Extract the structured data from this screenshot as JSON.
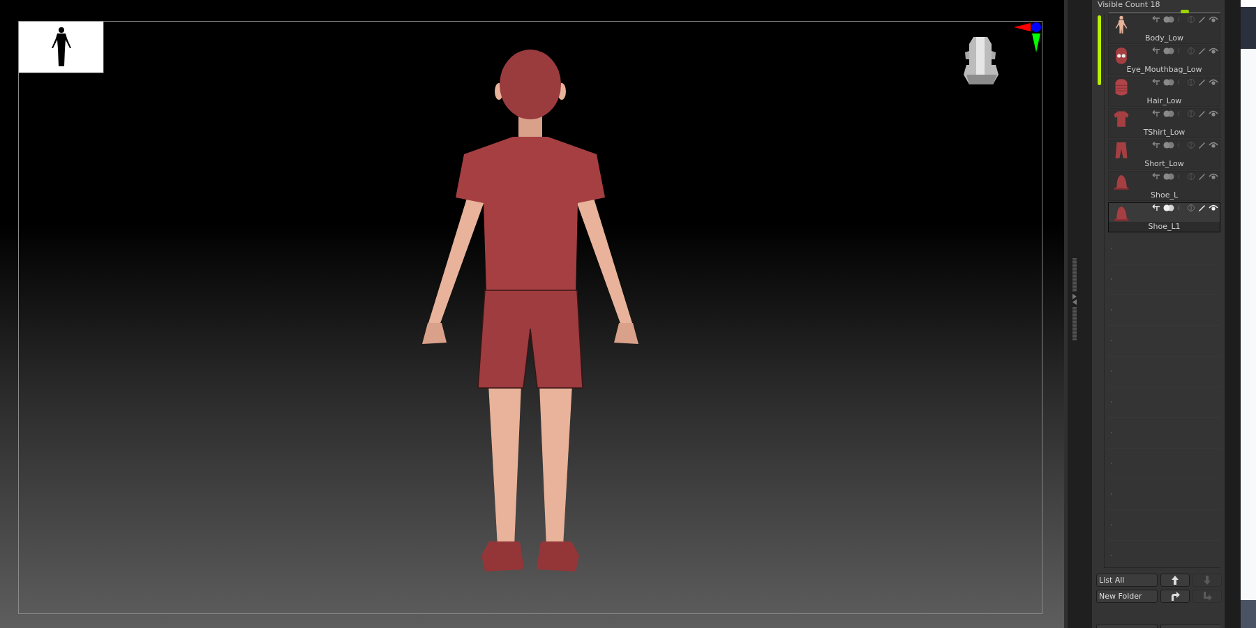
{
  "subtool_panel": {
    "visible_count": "Visible Count 18",
    "slider": {
      "level": 0.68
    },
    "subtools": [
      {
        "name": "Body_Low",
        "kind": "body",
        "selected": false,
        "visible": true
      },
      {
        "name": "Eye_Mouthbag_Low",
        "kind": "head",
        "selected": false,
        "visible": true
      },
      {
        "name": "Hair_Low",
        "kind": "hair",
        "selected": false,
        "visible": true
      },
      {
        "name": "TShirt_Low",
        "kind": "shirt",
        "selected": false,
        "visible": true
      },
      {
        "name": "Short_Low",
        "kind": "shorts",
        "selected": false,
        "visible": true
      },
      {
        "name": "Shoe_L",
        "kind": "shoe",
        "selected": false,
        "visible": true
      },
      {
        "name": "Shoe_L1",
        "kind": "shoe",
        "selected": true,
        "visible": true
      }
    ],
    "buttons": [
      {
        "label": "List All",
        "kind": "text",
        "disabled": false
      },
      {
        "kind": "up",
        "disabled": false
      },
      {
        "kind": "down",
        "disabled": true
      },
      {
        "label": "New Folder",
        "kind": "text",
        "disabled": false
      },
      {
        "kind": "turn",
        "disabled": false
      },
      {
        "kind": "turn-down",
        "disabled": true
      }
    ]
  }
}
